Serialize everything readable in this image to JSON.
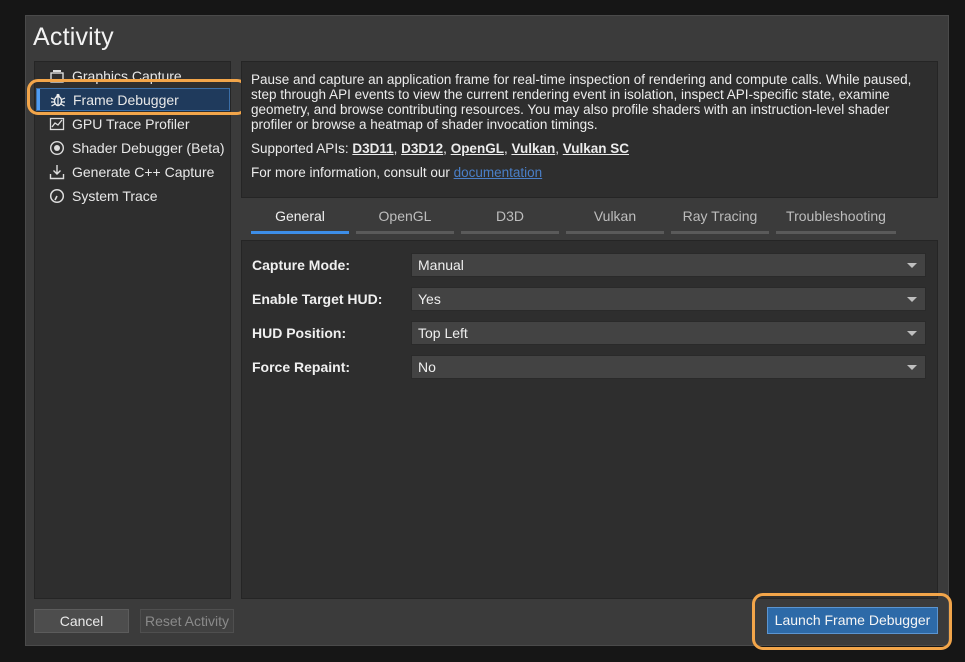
{
  "window": {
    "title": "Activity"
  },
  "sidebar": {
    "items": [
      {
        "label": "Graphics Capture",
        "icon": "camera-capture-icon",
        "selected": false
      },
      {
        "label": "Frame Debugger",
        "icon": "bug-icon",
        "selected": true
      },
      {
        "label": "GPU Trace Profiler",
        "icon": "trace-chart-icon",
        "selected": false
      },
      {
        "label": "Shader Debugger (Beta)",
        "icon": "record-circle-icon",
        "selected": false
      },
      {
        "label": "Generate C++ Capture",
        "icon": "download-tray-icon",
        "selected": false
      },
      {
        "label": "System Trace",
        "icon": "stopwatch-icon",
        "selected": false
      }
    ]
  },
  "info": {
    "description": "Pause and capture an application frame for real-time inspection of rendering and compute calls. While paused, step through API events to view the current rendering event in isolation, inspect API-specific state, examine geometry, and browse contributing resources. You may also profile shaders with an instruction-level shader profiler or browse a heatmap of shader invocation timings.",
    "supported_prefix": "Supported APIs:",
    "apis": [
      "D3D11",
      "D3D12",
      "OpenGL",
      "Vulkan",
      "Vulkan SC"
    ],
    "more_prefix": "For more information, consult our",
    "link_text": "documentation"
  },
  "tabs": [
    {
      "label": "General",
      "active": true
    },
    {
      "label": "OpenGL",
      "active": false
    },
    {
      "label": "D3D",
      "active": false
    },
    {
      "label": "Vulkan",
      "active": false
    },
    {
      "label": "Ray Tracing",
      "active": false
    },
    {
      "label": "Troubleshooting",
      "active": false
    }
  ],
  "settings": [
    {
      "label": "Capture Mode:",
      "value": "Manual"
    },
    {
      "label": "Enable Target HUD:",
      "value": "Yes"
    },
    {
      "label": "HUD Position:",
      "value": "Top Left"
    },
    {
      "label": "Force Repaint:",
      "value": "No"
    }
  ],
  "buttons": {
    "cancel": "Cancel",
    "reset": "Reset Activity",
    "launch": "Launch Frame Debugger"
  },
  "colors": {
    "accent": "#3d8ee8",
    "highlight": "#f2a54a",
    "link": "#4a7fc8",
    "launch_button": "#2d6aa8"
  }
}
